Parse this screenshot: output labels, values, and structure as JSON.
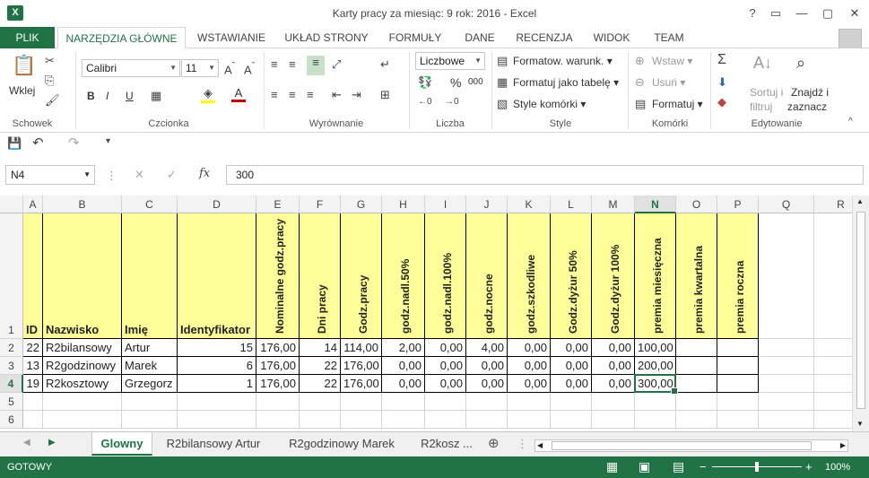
{
  "app": {
    "title": "Karty pracy za miesiąc: 9 rok: 2016 - Excel",
    "icon_letter": "X",
    "controls": [
      "?",
      "▭",
      "—",
      "▢",
      "✕"
    ]
  },
  "ribbon_tabs": {
    "file": "PLIK",
    "items": [
      "NARZĘDZIA GŁÓWNE",
      "WSTAWIANIE",
      "UKŁAD STRONY",
      "FORMUŁY",
      "DANE",
      "RECENZJA",
      "WIDOK",
      "TEAM"
    ]
  },
  "ribbon": {
    "clipboard": {
      "label": "Schowek",
      "paste": "Wklej"
    },
    "font": {
      "label": "Czcionka",
      "family": "Calibri",
      "size": "11",
      "bold": "B",
      "italic": "I",
      "underline": "U"
    },
    "alignment": {
      "label": "Wyrównanie"
    },
    "number": {
      "label": "Liczba",
      "format": "Liczbowe",
      "percent": "%",
      "thousands": "000"
    },
    "styles": {
      "label": "Style",
      "conditional": "Formatow. warunk.",
      "as_table": "Formatuj jako tabelę",
      "cell_styles": "Style komórki"
    },
    "cells": {
      "label": "Komórki",
      "insert": "Wstaw",
      "delete": "Usuń",
      "format": "Formatuj"
    },
    "editing": {
      "label": "Edytowanie",
      "sort_line1": "Sortuj i",
      "sort_line2": "filtruj",
      "find_line1": "Znajdź i",
      "find_line2": "zaznacz"
    }
  },
  "formula_bar": {
    "name_box": "N4",
    "fx": "fx",
    "value": "300"
  },
  "columns": [
    "A",
    "B",
    "C",
    "D",
    "E",
    "F",
    "G",
    "H",
    "I",
    "J",
    "K",
    "L",
    "M",
    "N",
    "O",
    "P",
    "Q",
    "R"
  ],
  "rows": [
    "1",
    "2",
    "3",
    "4",
    "5",
    "6"
  ],
  "header_row": {
    "A": "ID",
    "B": "Nazwisko",
    "C": "Imię",
    "D": "Identyfikator",
    "E": "Nominalne godz.pracy",
    "F": "Dni pracy",
    "G": "Godz.pracy",
    "H": "godz.nadl.50%",
    "I": "godz.nadl.100%",
    "J": "godz.nocne",
    "K": "godz.szkodliwe",
    "L": "Godz.dyżur 50%",
    "M": "Godz.dyżur 100%",
    "N": "premia miesięczna",
    "O": "premia kwartalna",
    "P": "premia roczna"
  },
  "data_rows": [
    [
      "22",
      "R2bilansowy",
      "Artur",
      "15",
      "176,00",
      "14",
      "114,00",
      "2,00",
      "0,00",
      "4,00",
      "0,00",
      "0,00",
      "0,00",
      "100,00",
      "",
      ""
    ],
    [
      "13",
      "R2godzinowy",
      "Marek",
      "6",
      "176,00",
      "22",
      "176,00",
      "0,00",
      "0,00",
      "0,00",
      "0,00",
      "0,00",
      "0,00",
      "200,00",
      "",
      ""
    ],
    [
      "19",
      "R2kosztowy",
      "Grzegorz",
      "1",
      "176,00",
      "22",
      "176,00",
      "0,00",
      "0,00",
      "0,00",
      "0,00",
      "0,00",
      "0,00",
      "300,00",
      "",
      ""
    ]
  ],
  "selected_cell": "N4",
  "sheets": [
    "Glowny",
    "R2bilansowy Artur",
    "R2godzinowy Marek",
    "R2kosz ..."
  ],
  "active_sheet": "Glowny",
  "status": {
    "mode": "GOTOWY",
    "zoom": "100%"
  },
  "colors": {
    "accent": "#217346",
    "header_fill": "#ffff99"
  }
}
